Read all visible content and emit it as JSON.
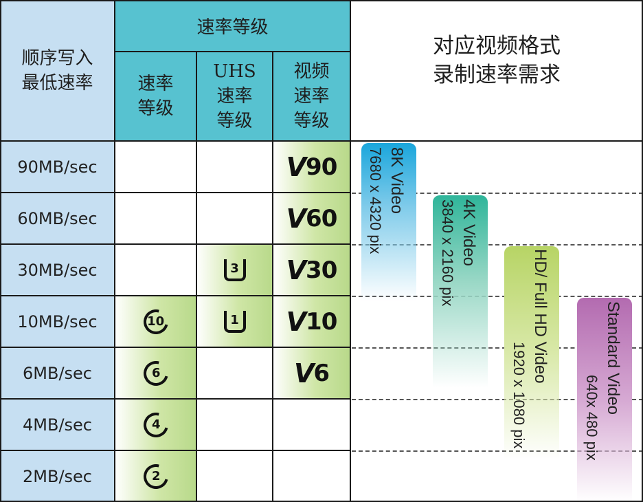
{
  "header": {
    "left_title_line1": "顺序写入",
    "left_title_line2": "最低速率",
    "rate_class_title": "速率等级",
    "col_speed_class_line1": "速率",
    "col_speed_class_line2": "等级",
    "col_uhs_line1": "UHS",
    "col_uhs_line2": "速率",
    "col_uhs_line3": "等级",
    "col_video_line1": "视频",
    "col_video_line2": "速率",
    "col_video_line3": "等级",
    "right_title_line1": "对应视频格式",
    "right_title_line2": "录制速率需求"
  },
  "rows": [
    {
      "speed": "90MB/sec",
      "class": "",
      "uhs": "",
      "video": "90"
    },
    {
      "speed": "60MB/sec",
      "class": "",
      "uhs": "",
      "video": "60"
    },
    {
      "speed": "30MB/sec",
      "class": "",
      "uhs": "3",
      "video": "30"
    },
    {
      "speed": "10MB/sec",
      "class": "10",
      "uhs": "1",
      "video": "10"
    },
    {
      "speed": "6MB/sec",
      "class": "6",
      "uhs": "",
      "video": "6"
    },
    {
      "speed": "4MB/sec",
      "class": "4",
      "uhs": "",
      "video": ""
    },
    {
      "speed": "2MB/sec",
      "class": "2",
      "uhs": "",
      "video": ""
    }
  ],
  "video_formats": [
    {
      "name": "8K Video",
      "res": "7680 x 4320 pix",
      "color": "#1aa6dc"
    },
    {
      "name": "4K Video",
      "res": "3840 x 2160 pix",
      "color": "#2fb59a"
    },
    {
      "name": "HD/ Full HD Video",
      "res": "1920 x 1080 pix",
      "color": "#b7d465"
    },
    {
      "name": "Standard Video",
      "res": "640x 480 pix",
      "color": "#b36bb0"
    }
  ],
  "colors": {
    "header_teal": "#57c2d0",
    "left_blue": "#c6dff2",
    "green_cell": "#b8d98a"
  }
}
